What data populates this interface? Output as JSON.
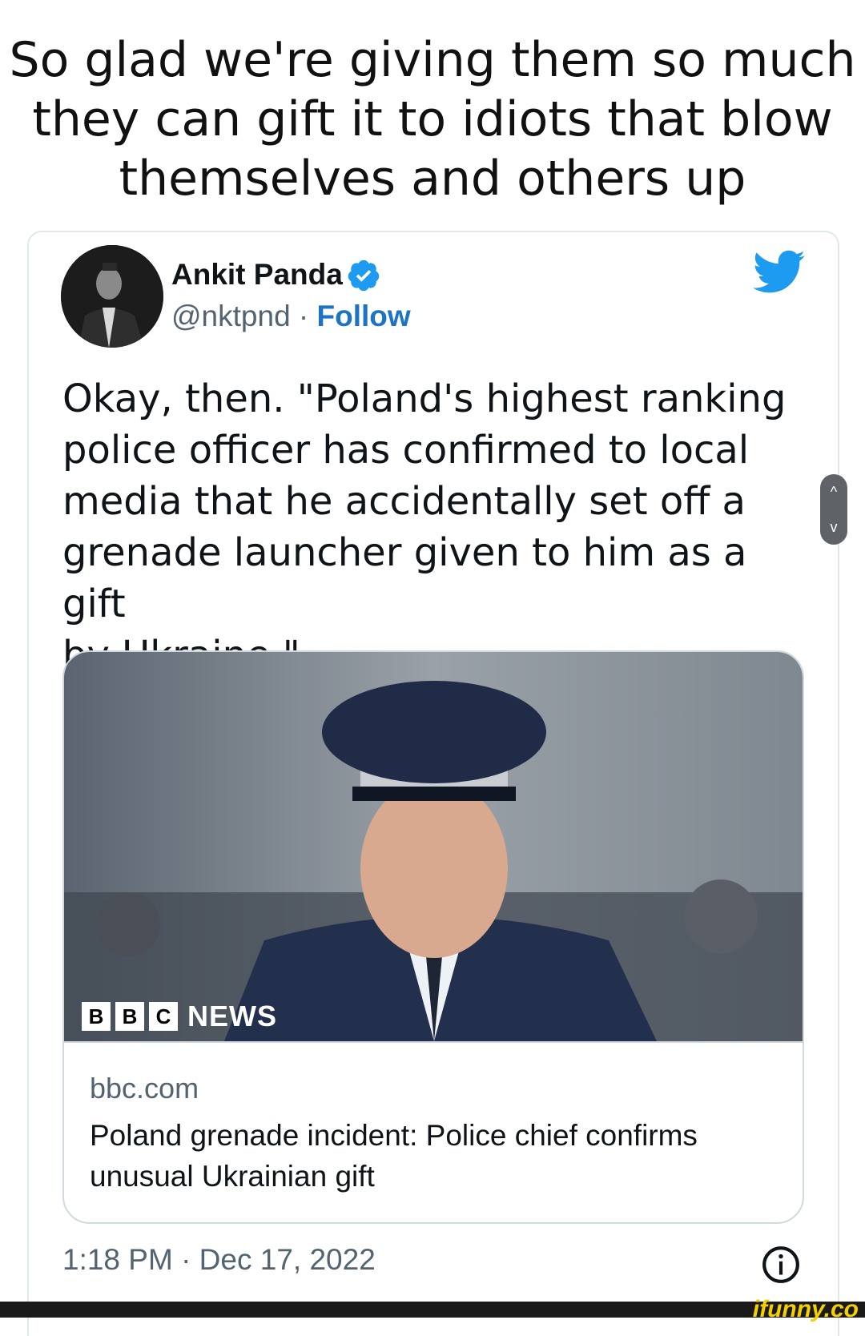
{
  "meme": {
    "caption_lines": [
      "So glad we're giving them so much",
      "they can gift it to idiots that blow",
      "themselves and others up"
    ]
  },
  "tweet": {
    "author_name": "Ankit Panda",
    "handle": "@nktpnd",
    "separator": " · ",
    "follow_label": "Follow",
    "text_lines": [
      "Okay, then. \"Poland's highest ranking",
      "police officer has confirmed to local",
      "media that he accidentally set off a",
      "grenade launcher given to him as a gift",
      "by Ukraine.\""
    ],
    "link_card": {
      "logo_letters": [
        "B",
        "B",
        "C"
      ],
      "logo_word": "NEWS",
      "domain": "bbc.com",
      "title_lines": [
        "Poland grenade incident: Police chief confirms",
        "unusual Ukrainian gift"
      ]
    },
    "timestamp": "1:18 PM · Dec 17, 2022"
  },
  "scroll_control": {
    "up": "^",
    "down": "v"
  },
  "watermark": "ifunny.co",
  "colors": {
    "link_blue": "#1d73c4",
    "twitter_blue": "#1d9bf0",
    "muted_text": "#536471",
    "card_border": "#cfd9de"
  },
  "icons": [
    "verified-badge-icon",
    "twitter-bird-icon",
    "info-icon",
    "chevron-up-icon",
    "chevron-down-icon"
  ]
}
